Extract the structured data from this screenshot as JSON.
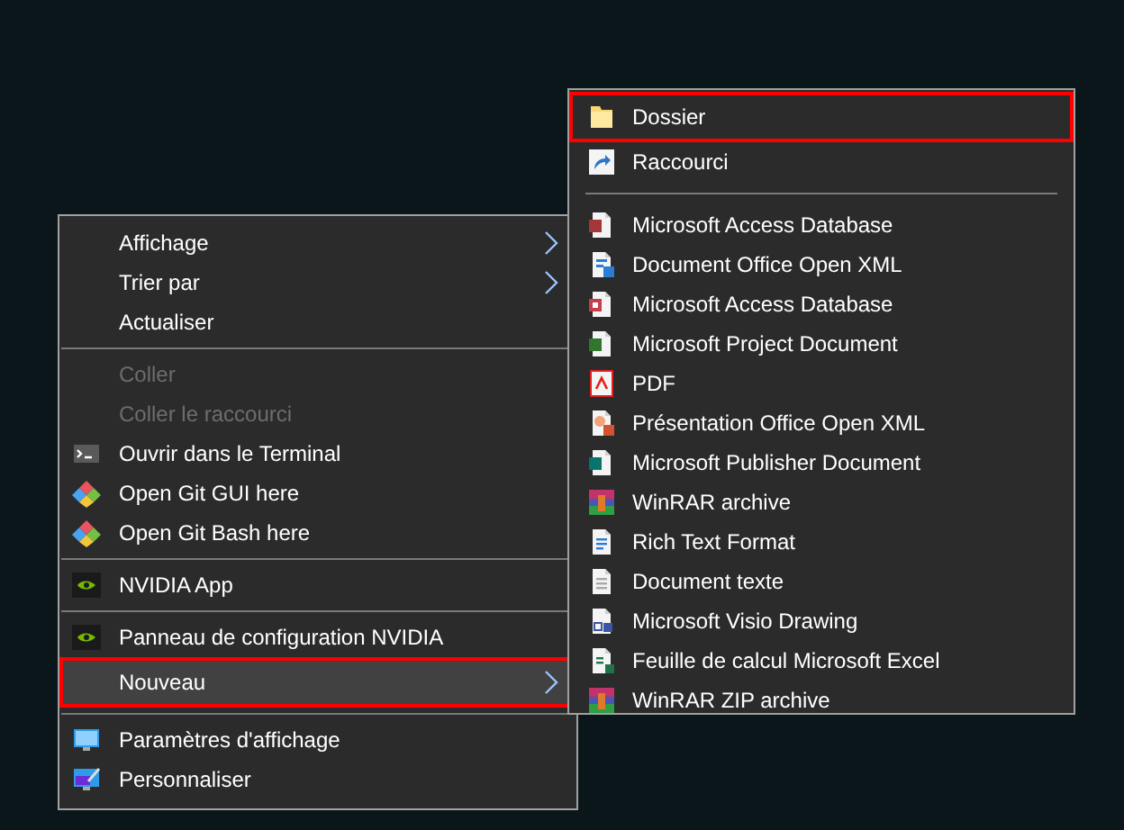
{
  "context_menu": {
    "groups": [
      [
        {
          "label": "Affichage",
          "submenu": true,
          "disabled": false,
          "selected": false,
          "highlighted": false
        },
        {
          "label": "Trier par",
          "submenu": true,
          "disabled": false,
          "selected": false,
          "highlighted": false
        },
        {
          "label": "Actualiser",
          "submenu": false,
          "disabled": false,
          "selected": false,
          "highlighted": false
        }
      ],
      [
        {
          "label": "Coller",
          "submenu": false,
          "disabled": true,
          "selected": false,
          "highlighted": false
        },
        {
          "label": "Coller le raccourci",
          "submenu": false,
          "disabled": true,
          "selected": false,
          "highlighted": false
        },
        {
          "label": "Ouvrir dans le Terminal",
          "kind": "terminal",
          "submenu": false,
          "disabled": false,
          "selected": false,
          "highlighted": false
        },
        {
          "label": "Open Git GUI here",
          "kind": "git",
          "submenu": false,
          "disabled": false,
          "selected": false,
          "highlighted": false
        },
        {
          "label": "Open Git Bash here",
          "kind": "git",
          "submenu": false,
          "disabled": false,
          "selected": false,
          "highlighted": false
        }
      ],
      [
        {
          "label": "NVIDIA App",
          "kind": "nvidia",
          "submenu": false,
          "disabled": false,
          "selected": false,
          "highlighted": false
        }
      ],
      [
        {
          "label": "Panneau de configuration NVIDIA",
          "kind": "nvidia",
          "submenu": false,
          "disabled": false,
          "selected": false,
          "highlighted": false
        },
        {
          "label": "Nouveau",
          "submenu": true,
          "disabled": false,
          "selected": true,
          "highlighted": true
        }
      ],
      [
        {
          "label": "Paramètres d'affichage",
          "kind": "display",
          "submenu": false,
          "disabled": false,
          "selected": false,
          "highlighted": false
        },
        {
          "label": "Personnaliser",
          "kind": "personalize",
          "submenu": false,
          "disabled": false,
          "selected": false,
          "highlighted": false
        }
      ]
    ]
  },
  "new_submenu": {
    "groups": [
      [
        {
          "label": "Dossier",
          "kind": "folder",
          "selected": false,
          "highlighted": true
        },
        {
          "label": "Raccourci",
          "kind": "shortcut",
          "selected": false,
          "highlighted": false
        }
      ],
      [
        {
          "label": "Microsoft Access Database",
          "kind": "access",
          "selected": false,
          "highlighted": false
        },
        {
          "label": "Document Office Open XML",
          "kind": "word",
          "selected": false,
          "highlighted": false
        },
        {
          "label": "Microsoft Access Database",
          "kind": "access2",
          "selected": false,
          "highlighted": false
        },
        {
          "label": "Microsoft Project Document",
          "kind": "project",
          "selected": false,
          "highlighted": false
        },
        {
          "label": "PDF",
          "kind": "pdf",
          "selected": false,
          "highlighted": false
        },
        {
          "label": "Présentation Office Open XML",
          "kind": "powerpoint",
          "selected": false,
          "highlighted": false
        },
        {
          "label": "Microsoft Publisher Document",
          "kind": "publisher",
          "selected": false,
          "highlighted": false
        },
        {
          "label": "WinRAR archive",
          "kind": "winrar",
          "selected": false,
          "highlighted": false
        },
        {
          "label": "Rich Text Format",
          "kind": "rtf",
          "selected": false,
          "highlighted": false
        },
        {
          "label": "Document texte",
          "kind": "text",
          "selected": false,
          "highlighted": false
        },
        {
          "label": "Microsoft Visio Drawing",
          "kind": "visio",
          "selected": false,
          "highlighted": false
        },
        {
          "label": "Feuille de calcul Microsoft Excel",
          "kind": "excel",
          "selected": false,
          "highlighted": false
        },
        {
          "label": "WinRAR ZIP archive",
          "kind": "winrar",
          "selected": false,
          "highlighted": false
        }
      ]
    ]
  }
}
